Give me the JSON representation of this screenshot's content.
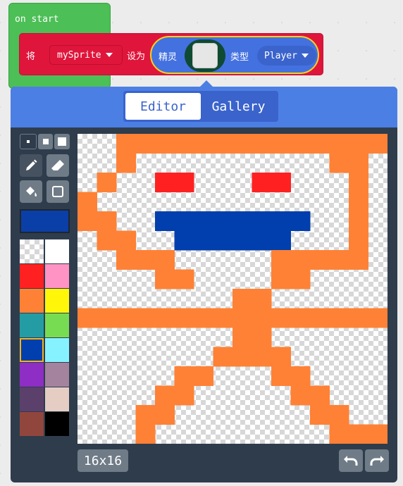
{
  "on_start": {
    "label": "on start"
  },
  "set_block": {
    "set_kw": "将",
    "variable": "mySprite",
    "to_kw": "设为",
    "sprite_kw": "精灵",
    "kind_kw": "类型",
    "kind": "Player"
  },
  "editor": {
    "tabs": [
      {
        "label": "Editor",
        "active": true
      },
      {
        "label": "Gallery",
        "active": false
      }
    ],
    "canvas_size": "16x16",
    "current_color": "#0a3fa8",
    "palette": [
      "transparent",
      "#ffffff",
      "#ff2121",
      "#ff93c4",
      "#ff8135",
      "#fff609",
      "#249ca3",
      "#78dc52",
      "#003fad",
      "#87f2ff",
      "#8e2ec4",
      "#a4839f",
      "#5c406c",
      "#e5cdc4",
      "#91463d",
      "#000000"
    ],
    "selected_palette_index": 8,
    "pixels": [
      "..oooooooooooooo",
      "..o..........oo.",
      ".o..rr...rr...o.",
      "o.............o.",
      "oo..bbbbbbbb..o.",
      ".oo..bbbbbb...o.",
      "..ooo.....ooooo.",
      "....oo....oo....",
      "........oo......",
      "ooooooooooooooooo",
      "........oo......",
      ".......oooo.....",
      ".....oo...oo....",
      "....oo.....oo...",
      "...oo.......oo..",
      "...o.........ooo"
    ],
    "pixel_colors": {
      "o": "#ff8135",
      "r": "#ff2121",
      "b": "#003fad"
    }
  },
  "icons": {
    "pencil": "pencil-icon",
    "eraser": "eraser-icon",
    "fill": "paint-bucket-icon",
    "rect": "rectangle-icon",
    "undo": "undo-icon",
    "redo": "redo-icon"
  }
}
